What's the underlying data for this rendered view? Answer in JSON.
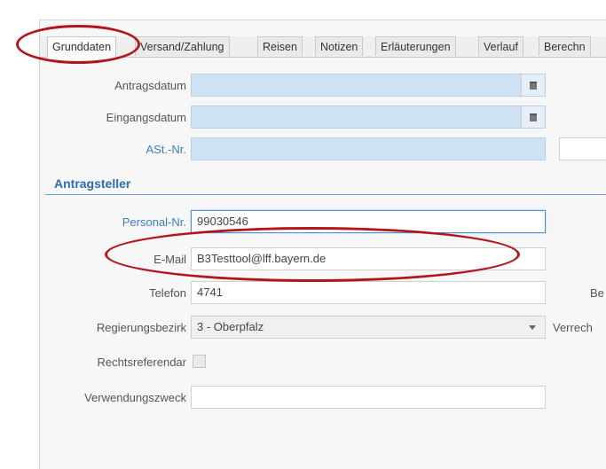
{
  "tabs": [
    "Grunddaten",
    "Versand/Zahlung",
    "Reisen",
    "Notizen",
    "Erläuterungen",
    "Verlauf",
    "Berechn"
  ],
  "form": {
    "antragsdatum_label": "Antragsdatum",
    "eingangsdatum_label": "Eingangsdatum",
    "ast_nr_label": "ASt.-Nr.",
    "section_title": "Antragsteller",
    "personal_nr_label": "Personal-Nr.",
    "personal_nr_value": "99030546",
    "email_label": "E-Mail",
    "email_value": "B3Testtool@lff.bayern.de",
    "telefon_label": "Telefon",
    "telefon_value": "4741",
    "telefon_side_label": "Be",
    "regierungsbezirk_label": "Regierungsbezirk",
    "regierungsbezirk_value": "3 - Oberpfalz",
    "regierungsbezirk_side_label": "Verrech",
    "rechtsreferendar_label": "Rechtsreferendar",
    "verwendungszweck_label": "Verwendungszweck"
  },
  "colors": {
    "required_field": "#cfe3f5",
    "annotation": "#b3151d",
    "section": "#2a6db3"
  }
}
